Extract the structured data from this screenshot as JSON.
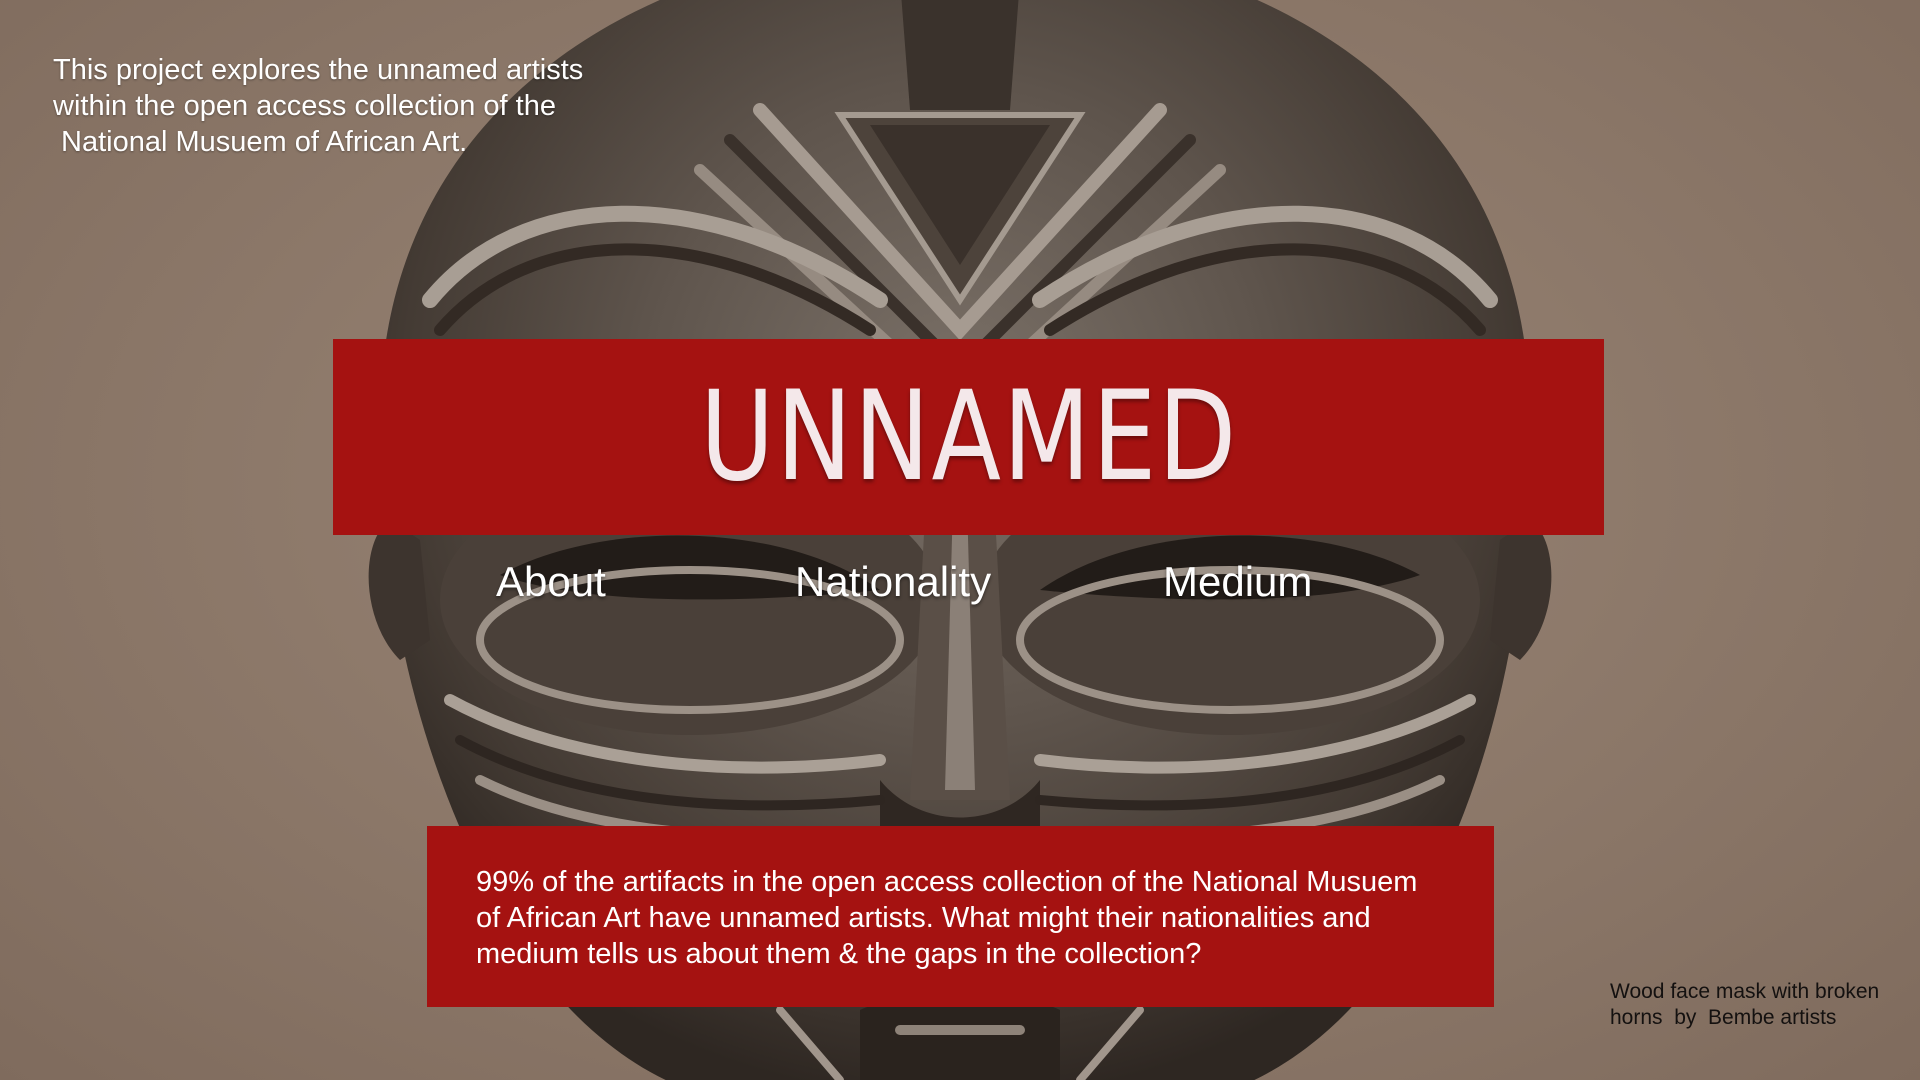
{
  "intro": {
    "lines": [
      "This project explores the unnamed artists",
      "within the open access collection of the",
      " National Musuem of African Art."
    ]
  },
  "title": "UNNAMED",
  "nav": {
    "about": "About",
    "nationality": "Nationality",
    "medium": "Medium"
  },
  "info": {
    "lines": [
      "99% of the artifacts in the open access collection of the National Musuem",
      "of African Art have unnamed artists. What might their nationalities and",
      "medium tells us about them & the gaps in the collection?"
    ]
  },
  "caption": {
    "lines": [
      "Wood face mask with broken",
      "horns  by  Bembe artists"
    ]
  },
  "colors": {
    "accent_red": "#a51211",
    "background": "#8e7a6b",
    "text_light": "#ffffff",
    "caption_text": "#141110"
  },
  "hero_image": "wood-face-mask-image"
}
